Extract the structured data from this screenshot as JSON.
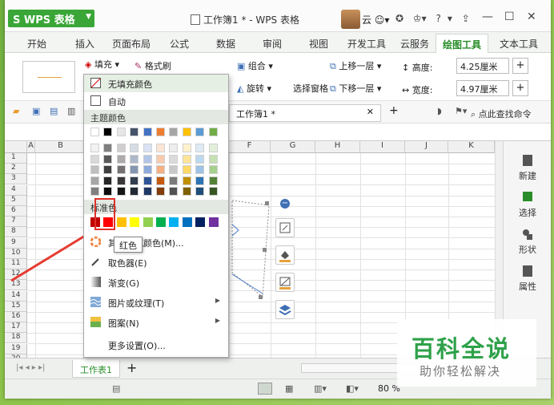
{
  "window": {
    "app_name": "WPS 表格",
    "doc_title": "工作簿1 * - WPS 表格",
    "user_name": "云",
    "help": "?"
  },
  "tabs": [
    {
      "label": "开始"
    },
    {
      "label": "插入"
    },
    {
      "label": "页面布局"
    },
    {
      "label": "公式"
    },
    {
      "label": "数据"
    },
    {
      "label": "审阅"
    },
    {
      "label": "视图"
    },
    {
      "label": "开发工具"
    },
    {
      "label": "云服务"
    },
    {
      "label": "绘图工具",
      "active": true
    },
    {
      "label": "文本工具"
    }
  ],
  "ribbon": {
    "fill_label": "填充",
    "format_brush_label": "格式刷",
    "group_label": "组合",
    "rotate_label": "旋转",
    "selection_pane_label": "选择窗格",
    "bring_forward_label": "上移一层",
    "send_backward_label": "下移一层",
    "height_label": "高度:",
    "width_label": "宽度:",
    "height_value": "4.25厘米",
    "width_value": "4.97厘米"
  },
  "qat": {
    "doc_tab": "工作簿1 *",
    "search_cmd": "点此查找命令"
  },
  "sheet": {
    "columns": [
      "A",
      "B",
      "C",
      "D",
      "E",
      "F",
      "G",
      "H",
      "I",
      "J",
      "K"
    ],
    "rows": [
      "1",
      "2",
      "3",
      "4",
      "5",
      "6",
      "7",
      "8",
      "9",
      "10",
      "11",
      "12",
      "13",
      "14",
      "15",
      "16",
      "17",
      "18",
      "19",
      "20"
    ]
  },
  "side_panel": [
    {
      "label": "新建",
      "icon": "new-doc-icon"
    },
    {
      "label": "选择",
      "icon": "select-icon"
    },
    {
      "label": "形状",
      "icon": "shape-icon"
    },
    {
      "label": "属性",
      "icon": "property-icon"
    }
  ],
  "sheet_tab": "工作表1",
  "status": {
    "zoom": "80 %"
  },
  "menu": {
    "no_fill": "无填充颜色",
    "auto": "自动",
    "theme_colors_header": "主题颜色",
    "standard_colors_header": "标准色",
    "more_colors": "其他填充颜色(M)...",
    "eyedropper": "取色器(E)",
    "gradient": "渐变(G)",
    "picture_texture": "图片或纹理(T)",
    "pattern": "图案(N)",
    "more_settings": "更多设置(O)...",
    "tooltip": "红色",
    "theme_top_row": [
      "#ffffff",
      "#000000",
      "#e7e6e6",
      "#44546a",
      "#4472c4",
      "#ed7d31",
      "#a5a5a5",
      "#ffc000",
      "#5b9bd5",
      "#70ad47"
    ],
    "theme_columns": [
      [
        "#f2f2f2",
        "#d9d9d9",
        "#bfbfbf",
        "#a6a6a6",
        "#808080"
      ],
      [
        "#7f7f7f",
        "#595959",
        "#3f3f3f",
        "#262626",
        "#0d0d0d"
      ],
      [
        "#d0cece",
        "#aeaaaa",
        "#757171",
        "#3a3838",
        "#161616"
      ],
      [
        "#d6dce4",
        "#adb9ca",
        "#8496b0",
        "#323f4f",
        "#222a35"
      ],
      [
        "#d9e2f3",
        "#b4c6e7",
        "#8eaadb",
        "#2f5496",
        "#1f3864"
      ],
      [
        "#fbe5d5",
        "#f7cbac",
        "#f4b183",
        "#c55a11",
        "#833c0b"
      ],
      [
        "#ededed",
        "#dbdbdb",
        "#c9c9c9",
        "#7b7b7b",
        "#525252"
      ],
      [
        "#fff2cc",
        "#fee599",
        "#ffd965",
        "#bf9000",
        "#7f6000"
      ],
      [
        "#deebf6",
        "#bdd7ee",
        "#9dc3e6",
        "#2e75b5",
        "#1e4e79"
      ],
      [
        "#e2efd9",
        "#c5e0b3",
        "#a8d08d",
        "#538135",
        "#375623"
      ]
    ],
    "standard_colors": [
      "#c00000",
      "#ff0000",
      "#ffc000",
      "#ffff00",
      "#92d050",
      "#00b050",
      "#00b0f0",
      "#0070c0",
      "#002060",
      "#7030a0"
    ]
  },
  "watermark": {
    "title": "百科全说",
    "subtitle": "助你轻松解决"
  }
}
